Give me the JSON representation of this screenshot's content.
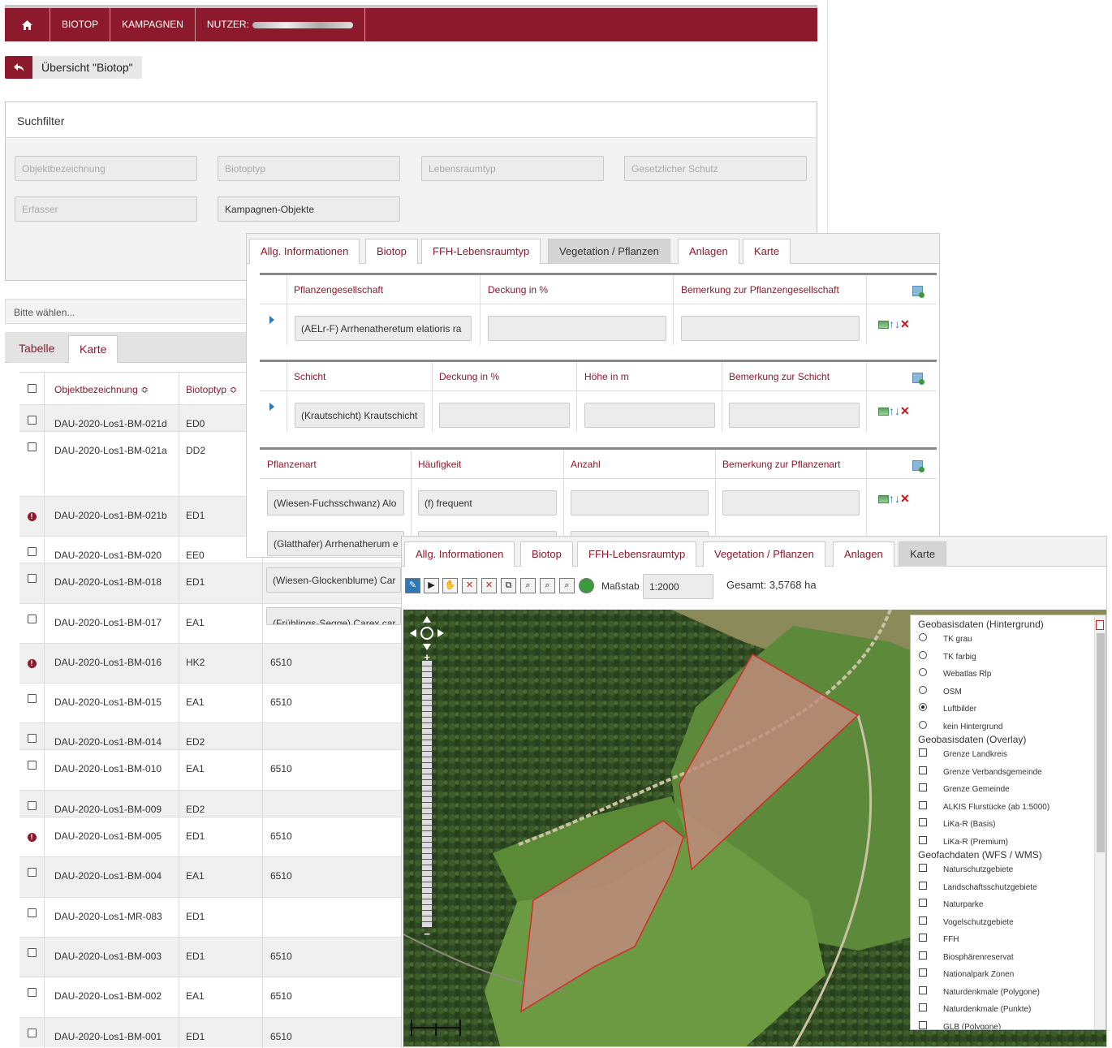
{
  "nav": {
    "items": [
      "BIOTOP",
      "KAMPAGNEN",
      "NUTZER:"
    ]
  },
  "back": {
    "label": "Übersicht \"Biotop\""
  },
  "filter": {
    "title": "Suchfilter",
    "fields": [
      "Objektbezeichnung",
      "Biotoptyp",
      "Lebensraumtyp",
      "Gesetzlicher Schutz",
      "Erfasser",
      "Kampagnen-Objekte"
    ]
  },
  "select": {
    "label": "Bitte wählen..."
  },
  "listtabs": [
    "Tabelle",
    "Karte"
  ],
  "table": {
    "headers": [
      "Objektbezeichnung ≎",
      "Biotoptyp ≎"
    ],
    "rows": [
      {
        "mark": "check",
        "name": "DAU-2020-Los1-BM-021d",
        "typ": "ED0",
        "lrt": ""
      },
      {
        "mark": "check",
        "name": "DAU-2020-Los1-BM-021a",
        "typ": "DD2",
        "lrt": ""
      },
      {
        "mark": "alert",
        "name": "DAU-2020-Los1-BM-021b",
        "typ": "ED1",
        "lrt": ""
      },
      {
        "mark": "check",
        "name": "DAU-2020-Los1-BM-020",
        "typ": "EE0",
        "lrt": ""
      },
      {
        "mark": "check",
        "name": "DAU-2020-Los1-BM-018",
        "typ": "ED1",
        "lrt": ""
      },
      {
        "mark": "check",
        "name": "DAU-2020-Los1-BM-017",
        "typ": "EA1",
        "lrt": ""
      },
      {
        "mark": "alert",
        "name": "DAU-2020-Los1-BM-016",
        "typ": "HK2",
        "lrt": "6510"
      },
      {
        "mark": "check",
        "name": "DAU-2020-Los1-BM-015",
        "typ": "EA1",
        "lrt": "6510"
      },
      {
        "mark": "check",
        "name": "DAU-2020-Los1-BM-014",
        "typ": "ED2",
        "lrt": ""
      },
      {
        "mark": "check",
        "name": "DAU-2020-Los1-BM-010",
        "typ": "EA1",
        "lrt": "6510"
      },
      {
        "mark": "check",
        "name": "DAU-2020-Los1-BM-009",
        "typ": "ED2",
        "lrt": ""
      },
      {
        "mark": "alert",
        "name": "DAU-2020-Los1-BM-005",
        "typ": "ED1",
        "lrt": "6510"
      },
      {
        "mark": "check",
        "name": "DAU-2020-Los1-BM-004",
        "typ": "EA1",
        "lrt": "6510"
      },
      {
        "mark": "check",
        "name": "DAU-2020-Los1-MR-083",
        "typ": "ED1",
        "lrt": ""
      },
      {
        "mark": "check",
        "name": "DAU-2020-Los1-BM-003",
        "typ": "ED1",
        "lrt": "6510"
      },
      {
        "mark": "check",
        "name": "DAU-2020-Los1-BM-002",
        "typ": "EA1",
        "lrt": "6510"
      },
      {
        "mark": "check",
        "name": "DAU-2020-Los1-BM-001",
        "typ": "ED1",
        "lrt": "6510"
      }
    ]
  },
  "detail_tabs": [
    "Allg. Informationen",
    "Biotop",
    "FFH-Lebensraumtyp",
    "Vegetation / Pflanzen",
    "Anlagen",
    "Karte"
  ],
  "vegetation": {
    "gesellschaft": {
      "headers": [
        "Pflanzengesellschaft",
        "Deckung in %",
        "Bemerkung zur Pflanzengesellschaft"
      ],
      "value": "(AELr-F) Arrhenatheretum elatioris ra"
    },
    "schicht": {
      "headers": [
        "Schicht",
        "Deckung in %",
        "Höhe in m",
        "Bemerkung zur Schicht"
      ],
      "value": "(Krautschicht) Krautschicht"
    },
    "arten": {
      "headers": [
        "Pflanzenart",
        "Häufigkeit",
        "Anzahl",
        "Bemerkung zur Pflanzenart"
      ],
      "rows": [
        {
          "art": "(Wiesen-Fuchsschwanz) Alo",
          "haeufigkeit": "(f) frequent"
        },
        {
          "art": "(Glatthafer) Arrhenatherum e",
          "haeufigkeit": ""
        },
        {
          "art": "(Wiesen-Glockenblume) Car",
          "haeufigkeit": ""
        },
        {
          "art": "(Frühlings-Segge) Carex car",
          "haeufigkeit": ""
        }
      ]
    }
  },
  "map": {
    "massstab_label": "Maßstab",
    "massstab_value": "1:2000",
    "gesamt": "Gesamt: 3,5768 ha",
    "layers": {
      "group1": "Geobasisdaten (Hintergrund)",
      "background": [
        {
          "label": "TK grau",
          "selected": false
        },
        {
          "label": "TK farbig",
          "selected": false
        },
        {
          "label": "Webatlas Rlp",
          "selected": false
        },
        {
          "label": "OSM",
          "selected": false
        },
        {
          "label": "Luftbilder",
          "selected": true
        },
        {
          "label": "kein Hintergrund",
          "selected": false
        }
      ],
      "group2": "Geobasisdaten (Overlay)",
      "overlay": [
        "Grenze Landkreis",
        "Grenze Verbandsgemeinde",
        "Grenze Gemeinde",
        "ALKIS Flurstücke (ab 1:5000)",
        "LiKa-R (Basis)",
        "LiKa-R (Premium)"
      ],
      "group3": "Geofachdaten (WFS / WMS)",
      "fach": [
        "Naturschutzgebiete",
        "Landschaftsschutzgebiete",
        "Naturparke",
        "Vogelschutzgebiete",
        "FFH",
        "Biosphärenreservat",
        "Nationalpark Zonen",
        "Naturdenkmale (Polygone)",
        "Naturdenkmale (Punkte)",
        "GLB (Polygone)"
      ]
    }
  },
  "colors": {
    "brand": "#8c1a2c",
    "link": "#8c1a2c",
    "polygon": "#c24a4a"
  }
}
